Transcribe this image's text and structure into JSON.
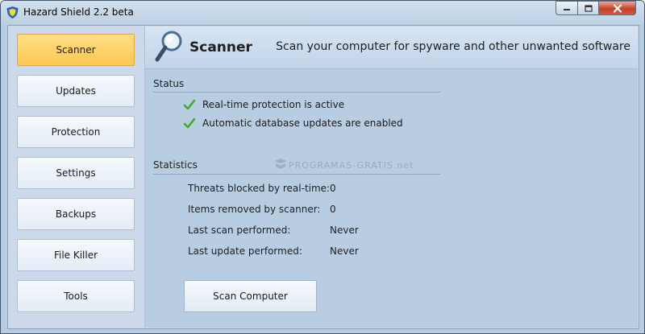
{
  "window": {
    "title": "Hazard Shield 2.2 beta"
  },
  "sidebar": {
    "items": [
      {
        "label": "Scanner",
        "active": true
      },
      {
        "label": "Updates"
      },
      {
        "label": "Protection"
      },
      {
        "label": "Settings"
      },
      {
        "label": "Backups"
      },
      {
        "label": "File Killer"
      },
      {
        "label": "Tools"
      }
    ]
  },
  "header": {
    "title": "Scanner",
    "description": "Scan your computer for spyware and other unwanted software",
    "icon": "magnifier-icon"
  },
  "status": {
    "title": "Status",
    "items": [
      "Real-time protection is active",
      "Automatic database updates are enabled"
    ]
  },
  "statistics": {
    "title": "Statistics",
    "rows": [
      {
        "label": "Threats blocked by real-time:",
        "value": "0"
      },
      {
        "label": "Items removed by scanner:",
        "value": "0"
      },
      {
        "label": "Last scan performed:",
        "value": "Never"
      },
      {
        "label": "Last update performed:",
        "value": "Never"
      }
    ]
  },
  "actions": {
    "scan_button": "Scan Computer"
  },
  "watermark": "PROGRAMAS-GRATIS.net",
  "colors": {
    "accent": "#fdc855",
    "check": "#3fae2a",
    "close": "#c5432a"
  }
}
